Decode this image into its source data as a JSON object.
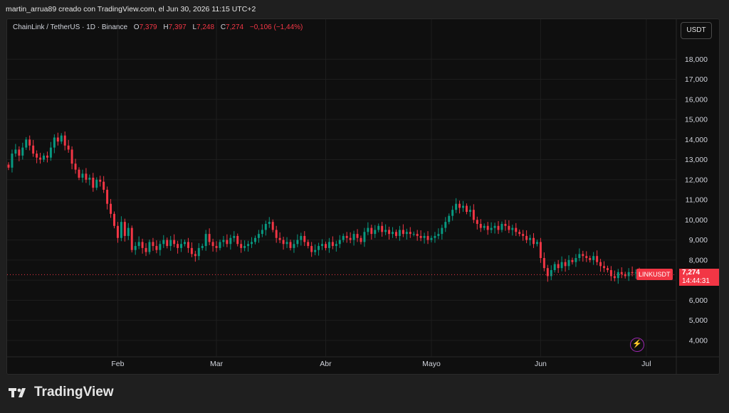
{
  "header": {
    "caption": "martin_arrua89 creado con TradingView.com, el Jun 30, 2026 11:15 UTC+2"
  },
  "legend": {
    "symbol": "ChainLink / TetherUS · 1D · Binance",
    "open_label": "O",
    "open": "7,379",
    "high_label": "H",
    "high": "7,397",
    "low_label": "L",
    "low": "7,248",
    "close_label": "C",
    "close": "7,274",
    "change": "−0,106 (−1,44%)"
  },
  "currency_button": "USDT",
  "last_price": {
    "symbol": "LINKUSDT",
    "price": "7,274",
    "countdown": "14:44:31"
  },
  "footer": {
    "brand": "TradingView"
  },
  "colors": {
    "up": "#089981",
    "down": "#f23645",
    "background": "#0f0f0f",
    "grid": "#1e1e1e"
  },
  "chart_data": {
    "type": "candlestick",
    "ylim": [
      3500,
      19000
    ],
    "y_ticks": [
      4000,
      5000,
      6000,
      7000,
      8000,
      9000,
      10000,
      11000,
      12000,
      13000,
      14000,
      15000,
      16000,
      17000,
      18000
    ],
    "y_tick_labels": [
      "4,000",
      "5,000",
      "6,000",
      "7,000",
      "8,000",
      "9,000",
      "10,000",
      "11,000",
      "12,000",
      "13,000",
      "14,000",
      "15,000",
      "16,000",
      "17,000",
      "18,000"
    ],
    "x_labels": [
      "Feb",
      "Mar",
      "Abr",
      "Mayo",
      "Jun",
      "Jul"
    ],
    "x_label_index": [
      31,
      59,
      90,
      120,
      151,
      181
    ],
    "last_close": 7.274,
    "series_units": "thousands of USDT",
    "closes": [
      12.6,
      13.3,
      13.5,
      13.2,
      13.6,
      14.0,
      13.7,
      13.3,
      13.1,
      13.0,
      13.2,
      13.1,
      13.6,
      14.1,
      13.9,
      14.2,
      13.7,
      13.5,
      12.8,
      12.5,
      12.1,
      12.3,
      12.0,
      12.1,
      11.6,
      12.0,
      11.9,
      11.5,
      10.8,
      10.3,
      9.7,
      9.1,
      9.9,
      9.2,
      9.6,
      8.5,
      8.7,
      8.9,
      8.6,
      8.4,
      8.9,
      8.7,
      8.5,
      8.8,
      9.0,
      8.7,
      9.0,
      8.8,
      8.6,
      8.8,
      8.9,
      8.6,
      8.3,
      8.2,
      8.6,
      8.7,
      9.3,
      8.9,
      8.7,
      8.6,
      8.9,
      9.0,
      8.8,
      9.1,
      9.2,
      8.8,
      8.6,
      8.7,
      8.8,
      8.9,
      9.1,
      9.3,
      9.5,
      9.8,
      9.9,
      9.5,
      9.1,
      9.0,
      8.8,
      8.9,
      8.6,
      8.8,
      9.0,
      9.2,
      8.9,
      8.7,
      8.4,
      8.5,
      8.7,
      8.8,
      8.6,
      8.9,
      8.7,
      8.8,
      9.0,
      9.2,
      9.1,
      9.0,
      9.3,
      9.1,
      8.9,
      9.4,
      9.6,
      9.3,
      9.5,
      9.7,
      9.4,
      9.5,
      9.3,
      9.4,
      9.2,
      9.5,
      9.3,
      9.4,
      9.3,
      9.3,
      9.2,
      9.1,
      9.2,
      9.0,
      9.1,
      9.2,
      9.3,
      9.6,
      9.9,
      10.2,
      10.5,
      10.8,
      10.6,
      10.7,
      10.4,
      10.5,
      10.0,
      9.8,
      9.6,
      9.7,
      9.5,
      9.6,
      9.7,
      9.5,
      9.8,
      9.7,
      9.5,
      9.6,
      9.4,
      9.3,
      9.2,
      9.0,
      9.1,
      8.8,
      8.9,
      8.1,
      7.6,
      7.2,
      7.5,
      7.8,
      7.6,
      7.9,
      7.7,
      8.0,
      7.9,
      8.1,
      8.3,
      8.2,
      8.1,
      8.0,
      8.2,
      7.9,
      7.7,
      7.6,
      7.5,
      7.2,
      7.1,
      7.4,
      7.3,
      7.2,
      7.4,
      7.35,
      7.38,
      7.274
    ]
  }
}
